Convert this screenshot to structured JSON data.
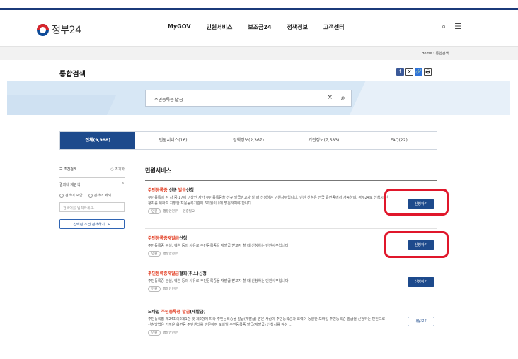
{
  "header": {
    "logo": "정부24",
    "nav": [
      "MyGOV",
      "민원서비스",
      "보조금24",
      "정책정보",
      "고객센터"
    ],
    "icons": [
      "search-icon",
      "menu-icon"
    ]
  },
  "breadcrumb": {
    "home": "Home",
    "sep": "›",
    "current": "통합검색"
  },
  "page": {
    "title": "통합검색"
  },
  "share_icons": {
    "facebook": "f",
    "x": "X",
    "link": "🔗",
    "print": "🖶"
  },
  "search": {
    "value": "주민등록증 발급",
    "clear": "×",
    "icon": "⌕"
  },
  "tabs": [
    {
      "label": "전체(9,988)",
      "active": true
    },
    {
      "label": "민원서비스(16)",
      "active": false
    },
    {
      "label": "정책정보(2,367)",
      "active": false
    },
    {
      "label": "기관정보(7,583)",
      "active": false
    },
    {
      "label": "FAQ(22)",
      "active": false
    }
  ],
  "sidebar": {
    "filter_label": "조건검색",
    "reset_label": "초기화",
    "within_label": "결과내 재검색",
    "include_label": "검색어 포함",
    "exclude_label": "검색어 제외",
    "input_placeholder": "검색어를 입력하세요.",
    "apply_label": "선택된 조건 검색하기"
  },
  "results": {
    "section_title": "민원서비스",
    "items": [
      {
        "title_pre": "",
        "title_hl": "주민등록증 ",
        "title_mid": "신규 ",
        "title_hl2": "발급",
        "title_post": "신청",
        "desc": "주민등록이 된 자 중 17세 이상인 자가 주민등록증을 신규 발급받고자 할 때 신청하는 민원사무입니다. 민원 신청은 전국 읍면동에서 가능하며, 정부24로 신청시 신청자를 위하여 지정한 지문등록기관에 6개월이내에 방문하여야 합니다.",
        "tag": "민원",
        "org": "행정안전부",
        "extra": "인증필요",
        "button": "신청하기"
      },
      {
        "title_pre": "",
        "title_hl": "주민등록증재발급",
        "title_mid": "",
        "title_hl2": "",
        "title_post": "신청",
        "desc": "주민등록증 분실, 훼손 등의 사유로 주민등록증을 재발급 받고자 할 때 신청하는 민원사무입니다.",
        "tag": "민원",
        "org": "행정안전부",
        "extra": "",
        "button": "신청하기"
      },
      {
        "title_pre": "",
        "title_hl": "주민등록증재발급",
        "title_mid": "",
        "title_hl2": "",
        "title_post": "철회(취소)신청",
        "desc": "주민등록증 분실, 훼손 등의 사유로 주민등록증을 재발급 받고자 할 때 신청하는 민원사무입니다.",
        "tag": "민원",
        "org": "행정안전부",
        "extra": "",
        "button": "신청하기"
      },
      {
        "title_pre": "모바일 ",
        "title_hl": "주민등록증 ",
        "title_mid": "",
        "title_hl2": "발급",
        "title_post": "(재발급)",
        "desc": "주민등록법 제24조의2제1항 및 제2항에 따라 주민등록증을 발급(재발급) 받은 사람이 주민등록증과 효력이 동일한 모바일 주민등록증 발급을 신청하는 민원으로 신청방법은 가까운 읍면동 주민센터를 방문하여 모바일 주민등록증 발급(재발급) 신청서를 작성 ...",
        "tag": "민원",
        "org": "행정안전부",
        "extra": "",
        "button": "내용보기"
      }
    ]
  },
  "colors": {
    "accent": "#1d4a8c",
    "highlight": "#e1361a",
    "ring": "#e0172b"
  }
}
